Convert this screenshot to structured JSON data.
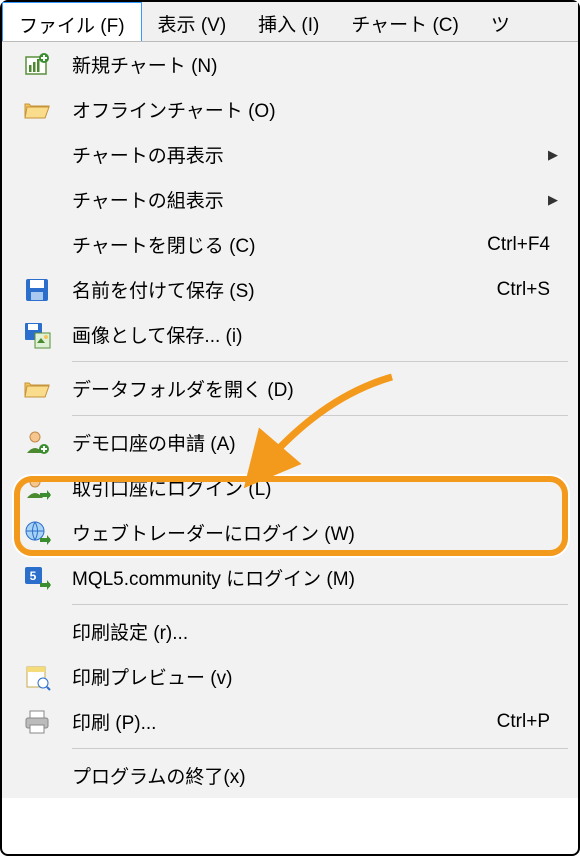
{
  "menubar": {
    "items": [
      {
        "label": "ファイル (F)",
        "active": true
      },
      {
        "label": "表示 (V)"
      },
      {
        "label": "挿入 (I)"
      },
      {
        "label": "チャート (C)"
      },
      {
        "label": "ツ"
      }
    ]
  },
  "menu": {
    "items": [
      {
        "icon": "new-chart",
        "label": "新規チャート (N)"
      },
      {
        "icon": "open-folder",
        "label": "オフラインチャート (O)"
      },
      {
        "icon": "",
        "label": "チャートの再表示",
        "submenu": true
      },
      {
        "icon": "",
        "label": "チャートの組表示",
        "submenu": true
      },
      {
        "icon": "",
        "label": "チャートを閉じる (C)",
        "shortcut": "Ctrl+F4"
      },
      {
        "icon": "save",
        "label": "名前を付けて保存 (S)",
        "shortcut": "Ctrl+S"
      },
      {
        "icon": "save-image",
        "label": "画像として保存... (i)"
      },
      {
        "sep": true
      },
      {
        "icon": "open-folder",
        "label": "データフォルダを開く (D)"
      },
      {
        "sep": true
      },
      {
        "icon": "user-add",
        "label": "デモ口座の申請 (A)"
      },
      {
        "icon": "user-login",
        "label": "取引口座にログイン (L)",
        "highlighted": true
      },
      {
        "icon": "web-login",
        "label": "ウェブトレーダーにログイン (W)"
      },
      {
        "icon": "mql5",
        "label": "MQL5.community にログイン (M)"
      },
      {
        "sep": true
      },
      {
        "icon": "",
        "label": "印刷設定 (r)..."
      },
      {
        "icon": "print-preview",
        "label": "印刷プレビュー (v)"
      },
      {
        "icon": "print",
        "label": "印刷 (P)...",
        "shortcut": "Ctrl+P"
      },
      {
        "sep": true
      },
      {
        "icon": "",
        "label": "プログラムの終了(x)"
      }
    ]
  }
}
